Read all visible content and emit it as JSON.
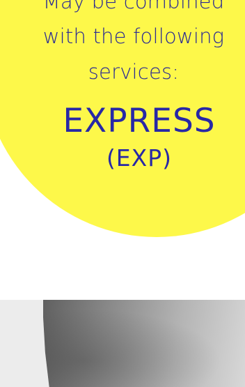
{
  "promo": {
    "intro_line1": "May be combined",
    "intro_line2": "with the following",
    "intro_line3": "services:",
    "service_name": "EXPRESS",
    "service_code": "(EXP)"
  },
  "colors": {
    "circle": "#fdf84a",
    "text": "#2a2a93",
    "band": "#ececec"
  }
}
